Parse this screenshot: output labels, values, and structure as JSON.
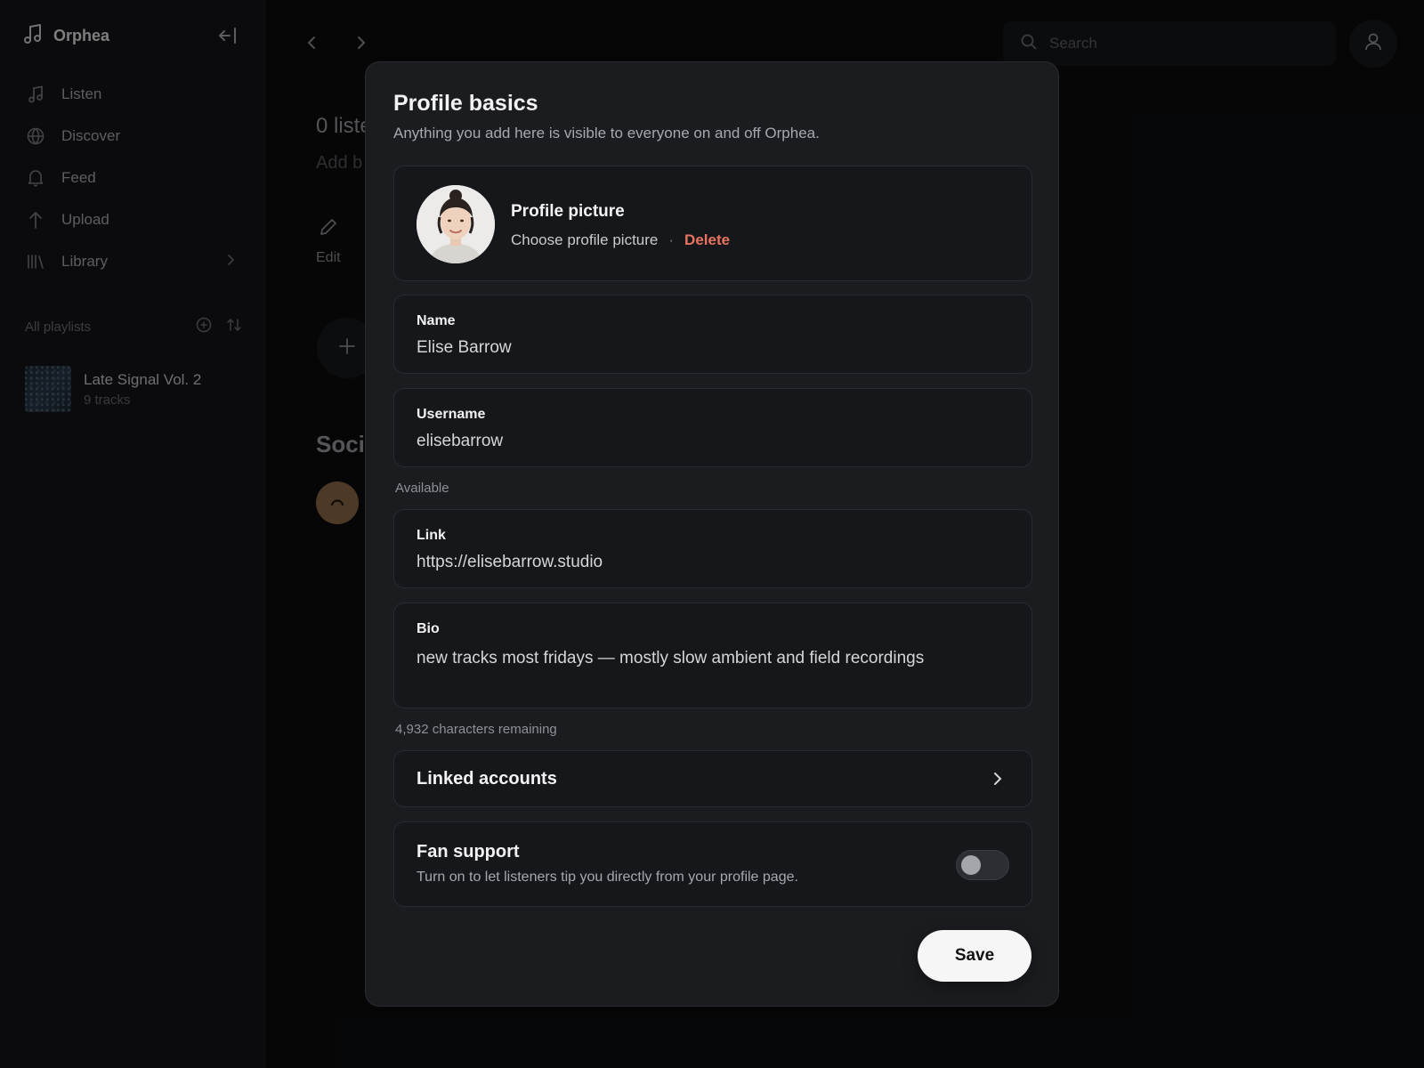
{
  "app": {
    "name": "Orphea"
  },
  "sidebar": {
    "items": [
      {
        "label": "Listen",
        "icon": "music-note-icon"
      },
      {
        "label": "Discover",
        "icon": "globe-icon"
      },
      {
        "label": "Feed",
        "icon": "bell-icon"
      },
      {
        "label": "Upload",
        "icon": "arrow-up-icon"
      },
      {
        "label": "Library",
        "icon": "library-icon"
      }
    ],
    "playlists_label": "All playlists",
    "playlists": [
      {
        "title": "Late Signal Vol. 2",
        "subtitle": "9 tracks"
      }
    ]
  },
  "topbar": {
    "search_placeholder": "Search"
  },
  "background_page": {
    "listeners": "0 liste",
    "add_bio": "Add b",
    "edit_label": "Edit",
    "social_heading": "Soci"
  },
  "modal": {
    "title": "Profile basics",
    "subtitle": "Anything you add here is visible to everyone on and off Orphea.",
    "picture": {
      "title": "Profile picture",
      "choose": "Choose profile picture",
      "separator": "·",
      "delete": "Delete"
    },
    "name": {
      "label": "Name",
      "value": "Elise Barrow"
    },
    "username": {
      "label": "Username",
      "value": "elisebarrow",
      "status": "Available"
    },
    "link": {
      "label": "Link",
      "value": "https://elisebarrow.studio"
    },
    "bio": {
      "label": "Bio",
      "value": "new tracks most fridays — mostly slow ambient and field recordings",
      "remaining": "4,932 characters remaining"
    },
    "linked_accounts": {
      "label": "Linked accounts"
    },
    "fan_support": {
      "title": "Fan support",
      "description": "Turn on to let listeners tip you directly from your profile page.",
      "enabled": false
    },
    "save_label": "Save"
  },
  "colors": {
    "accent_delete": "#e8735f",
    "modal_bg": "#1b1c20",
    "save_bg": "#f6f6f7"
  }
}
